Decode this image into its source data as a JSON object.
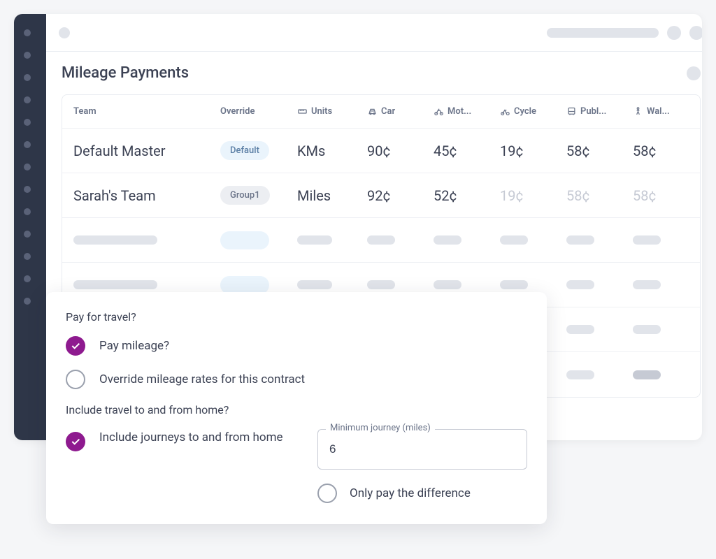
{
  "page": {
    "title": "Mileage Payments"
  },
  "table": {
    "headers": {
      "team": "Team",
      "override": "Override",
      "units": "Units",
      "car": "Car",
      "motorbike": "Mot...",
      "cycle": "Cycle",
      "public": "Publ...",
      "walking": "Wal..."
    },
    "rows": [
      {
        "team": "Default Master",
        "override": "Default",
        "override_style": "default",
        "units": "KMs",
        "car": "90¢",
        "motorbike": "45¢",
        "cycle": "19¢",
        "public": "58¢",
        "walking": "58¢",
        "faded": {
          "cycle": false,
          "public": false,
          "walking": false
        }
      },
      {
        "team": "Sarah's Team",
        "override": "Group1",
        "override_style": "grey",
        "units": "Miles",
        "car": "92¢",
        "motorbike": "52¢",
        "cycle": "19¢",
        "public": "58¢",
        "walking": "58¢",
        "faded": {
          "cycle": true,
          "public": true,
          "walking": true
        }
      }
    ]
  },
  "overlay": {
    "section1_label": "Pay for travel?",
    "opt_pay_mileage": "Pay mileage?",
    "opt_override_rates": "Override mileage rates for this contract",
    "section2_label": "Include travel to and from home?",
    "opt_include_home": "Include journeys to and from home",
    "min_journey_label": "Minimum journey (miles)",
    "min_journey_value": "6",
    "opt_pay_diff": "Only pay the difference"
  },
  "icons": {
    "units": "straighten",
    "car": "car",
    "motorbike": "motorbike",
    "cycle": "bicycle",
    "public": "bus",
    "walking": "walk"
  }
}
